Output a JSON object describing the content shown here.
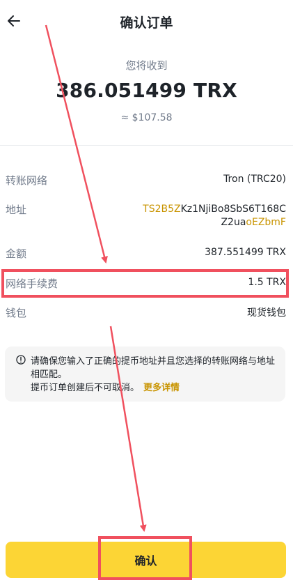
{
  "header": {
    "title": "确认订单",
    "back_icon": "arrow-left-icon"
  },
  "receive": {
    "label": "您将收到",
    "amount": "386.051499 TRX",
    "usd": "≈ $107.58"
  },
  "details": {
    "network": {
      "label": "转账网络",
      "value": "Tron (TRC20)"
    },
    "address": {
      "label": "地址",
      "line1_highlight": "TS2B5Z",
      "line1_rest": "Kz1NjiBo8SbS6T168C",
      "line2_rest": "Z2ua",
      "line2_highlight": "oEZbmF"
    },
    "amount": {
      "label": "金额",
      "value": "387.551499 TRX"
    },
    "fee": {
      "label": "网络手续费",
      "value": "1.5 TRX"
    },
    "wallet": {
      "label": "钱包",
      "value": "现货钱包"
    }
  },
  "notice": {
    "icon": "info-circle-icon",
    "line1": "请确保您输入了正确的提币地址并且您选择的转账网络与地址相匹配。",
    "line2": "提币订单创建后不可取消。",
    "more_link": "更多详情"
  },
  "confirm_button": {
    "label": "确认"
  },
  "colors": {
    "accent": "#fcd535",
    "highlight": "#c99400",
    "annotation": "#f0505e"
  }
}
